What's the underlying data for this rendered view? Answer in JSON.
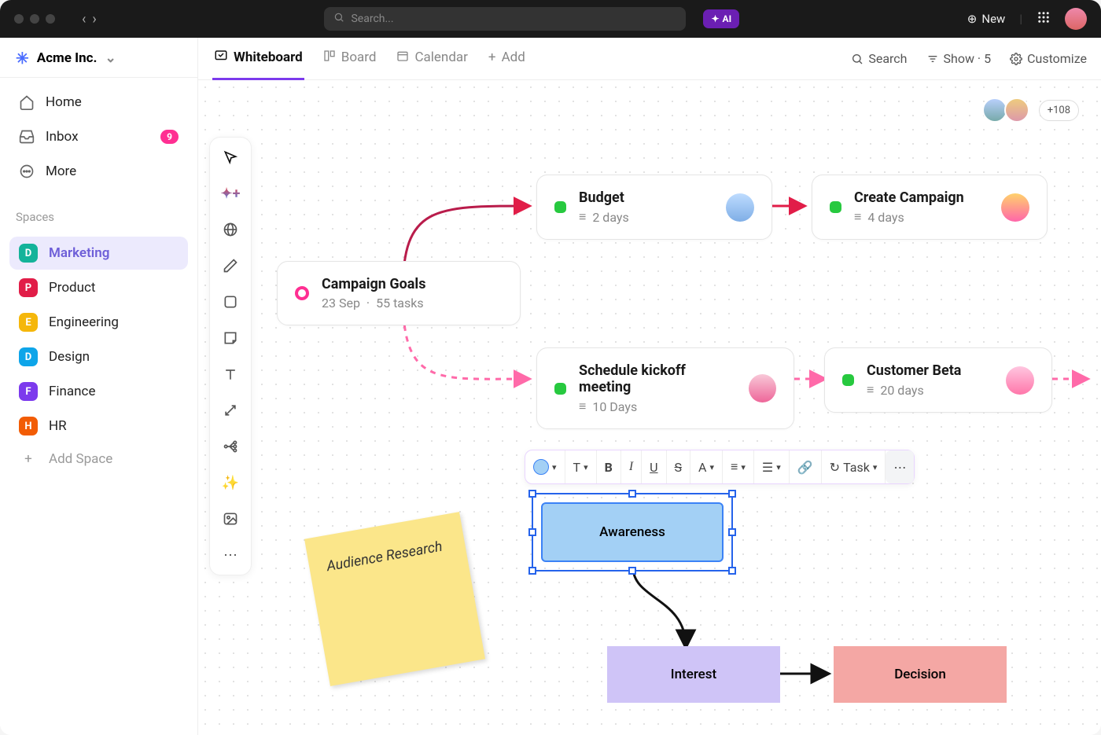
{
  "topbar": {
    "search_placeholder": "Search...",
    "ai_label": "AI",
    "new_label": "New"
  },
  "workspace": {
    "name": "Acme Inc."
  },
  "nav": {
    "home": "Home",
    "inbox": "Inbox",
    "inbox_badge": "9",
    "more": "More"
  },
  "spaces_label": "Spaces",
  "spaces": [
    {
      "letter": "D",
      "label": "Marketing",
      "color": "#14b39a",
      "active": true
    },
    {
      "letter": "P",
      "label": "Product",
      "color": "#e11d48"
    },
    {
      "letter": "E",
      "label": "Engineering",
      "color": "#f5b70b"
    },
    {
      "letter": "D",
      "label": "Design",
      "color": "#0ea5e9"
    },
    {
      "letter": "F",
      "label": "Finance",
      "color": "#7c3aed"
    },
    {
      "letter": "H",
      "label": "HR",
      "color": "#f25c05"
    }
  ],
  "add_space": "Add Space",
  "tabs": {
    "whiteboard": "Whiteboard",
    "board": "Board",
    "calendar": "Calendar",
    "add": "Add",
    "search": "Search",
    "show": "Show · 5",
    "customize": "Customize"
  },
  "collab_more": "+108",
  "cards": {
    "goals": {
      "title": "Campaign Goals",
      "date": "23 Sep",
      "dot": "·",
      "tasks": "55 tasks"
    },
    "budget": {
      "title": "Budget",
      "meta": "2 days"
    },
    "create": {
      "title": "Create Campaign",
      "meta": "4 days"
    },
    "kickoff": {
      "title": "Schedule kickoff meeting",
      "meta": "10 Days"
    },
    "beta": {
      "title": "Customer Beta",
      "meta": "20 days"
    }
  },
  "sticky": "Audience Research",
  "flow": {
    "awareness": "Awareness",
    "interest": "Interest",
    "decision": "Decision"
  },
  "fmt": {
    "task": "Task",
    "t": "T",
    "b": "B",
    "i": "I",
    "u": "U",
    "s": "S",
    "a": "A"
  }
}
